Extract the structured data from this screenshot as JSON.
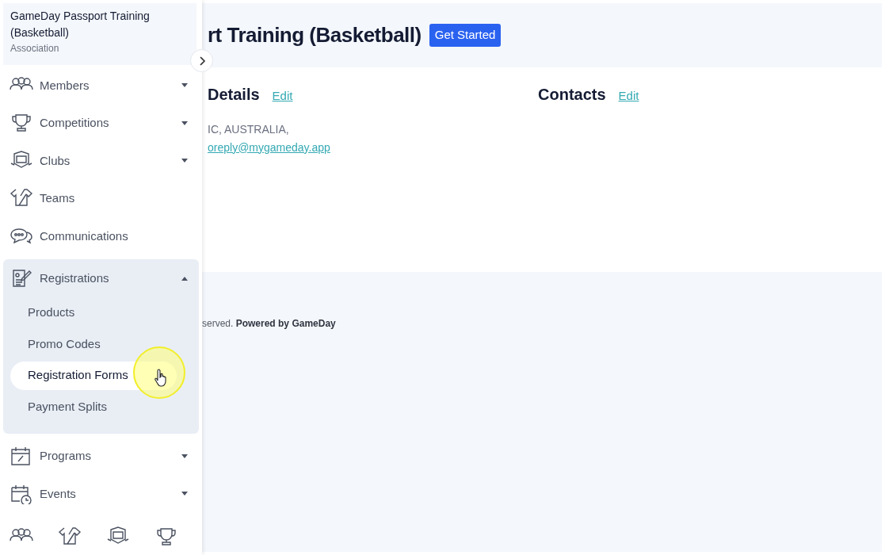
{
  "sidebar": {
    "org_name": "GameDay Passport Training (Basketball)",
    "org_type": "Association",
    "items": [
      {
        "label": "Members",
        "kind": "menu",
        "expanded": false
      },
      {
        "label": "Competitions",
        "kind": "menu",
        "expanded": false
      },
      {
        "label": "Clubs",
        "kind": "menu",
        "expanded": false
      },
      {
        "label": "Teams",
        "kind": "link"
      },
      {
        "label": "Communications",
        "kind": "link"
      },
      {
        "label": "Registrations",
        "kind": "menu",
        "expanded": true,
        "children": [
          {
            "label": "Products",
            "selected": false
          },
          {
            "label": "Promo Codes",
            "selected": false
          },
          {
            "label": "Registration Forms",
            "selected": true
          },
          {
            "label": "Payment Splits",
            "selected": false
          }
        ]
      },
      {
        "label": "Programs",
        "kind": "menu",
        "expanded": false
      },
      {
        "label": "Events",
        "kind": "menu",
        "expanded": false
      }
    ]
  },
  "page_header": {
    "title": "rt Training (Basketball)",
    "button": "Get Started"
  },
  "sections": [
    {
      "heading": "Details",
      "action": "Edit",
      "lines": [
        {
          "kind": "text",
          "text": "IC, AUSTRALIA,"
        },
        {
          "kind": "link",
          "text": "oreply@mygameday.app"
        }
      ]
    },
    {
      "heading": "Contacts",
      "action": "Edit"
    }
  ],
  "footer": "served. **Powered by GameDay**"
}
